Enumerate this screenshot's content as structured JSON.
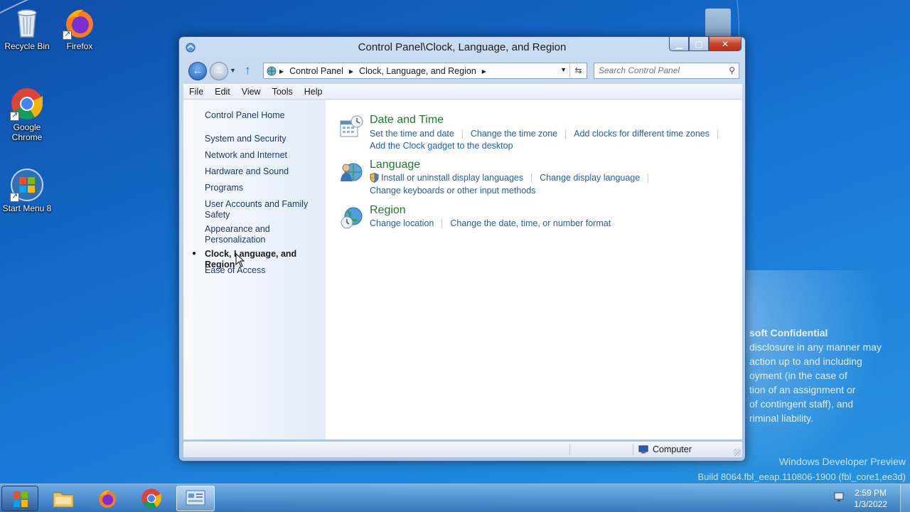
{
  "desktop": {
    "icons": [
      {
        "label": "Recycle Bin"
      },
      {
        "label": "Firefox"
      },
      {
        "label": "Google Chrome"
      },
      {
        "label": "Start Menu 8"
      }
    ],
    "watermark": {
      "title": "soft Confidential",
      "lines": [
        "disclosure in any manner may",
        "action up to and including",
        "oyment (in the case of",
        "tion of an assignment or",
        "of contingent staff), and",
        "riminal liability."
      ]
    },
    "build": {
      "line1": "Windows Developer Preview",
      "line2": "Build 8064.fbl_eeap.110806-1900 (fbl_core1,ee3d)"
    }
  },
  "window": {
    "title": "Control Panel\\Clock, Language, and Region",
    "address": {
      "crumbs": [
        "Control Panel",
        "Clock, Language, and Region"
      ]
    },
    "search": {
      "placeholder": "Search Control Panel"
    },
    "menu": [
      "File",
      "Edit",
      "View",
      "Tools",
      "Help"
    ],
    "left_nav": {
      "home": "Control Panel Home",
      "items": [
        "System and Security",
        "Network and Internet",
        "Hardware and Sound",
        "Programs",
        "User Accounts and Family Safety",
        "Appearance and Personalization",
        "Clock, Language, and Region",
        "Ease of Access"
      ],
      "active_index": 6
    },
    "categories": [
      {
        "title": "Date and Time",
        "tasks": [
          "Set the time and date",
          "Change the time zone",
          "Add clocks for different time zones",
          "Add the Clock gadget to the desktop"
        ]
      },
      {
        "title": "Language",
        "tasks": [
          "Install or uninstall display languages",
          "Change display language",
          "Change keyboards or other input methods"
        ]
      },
      {
        "title": "Region",
        "tasks": [
          "Change location",
          "Change the date, time, or number format"
        ]
      }
    ],
    "status": {
      "zone": "Computer"
    }
  },
  "taskbar": {
    "time": "2:59 PM",
    "date": "1/3/2022"
  },
  "colors": {
    "category_title": "#1e7a2e",
    "task_link": "#1e5fb4",
    "nav_link": "#1c3a66"
  }
}
